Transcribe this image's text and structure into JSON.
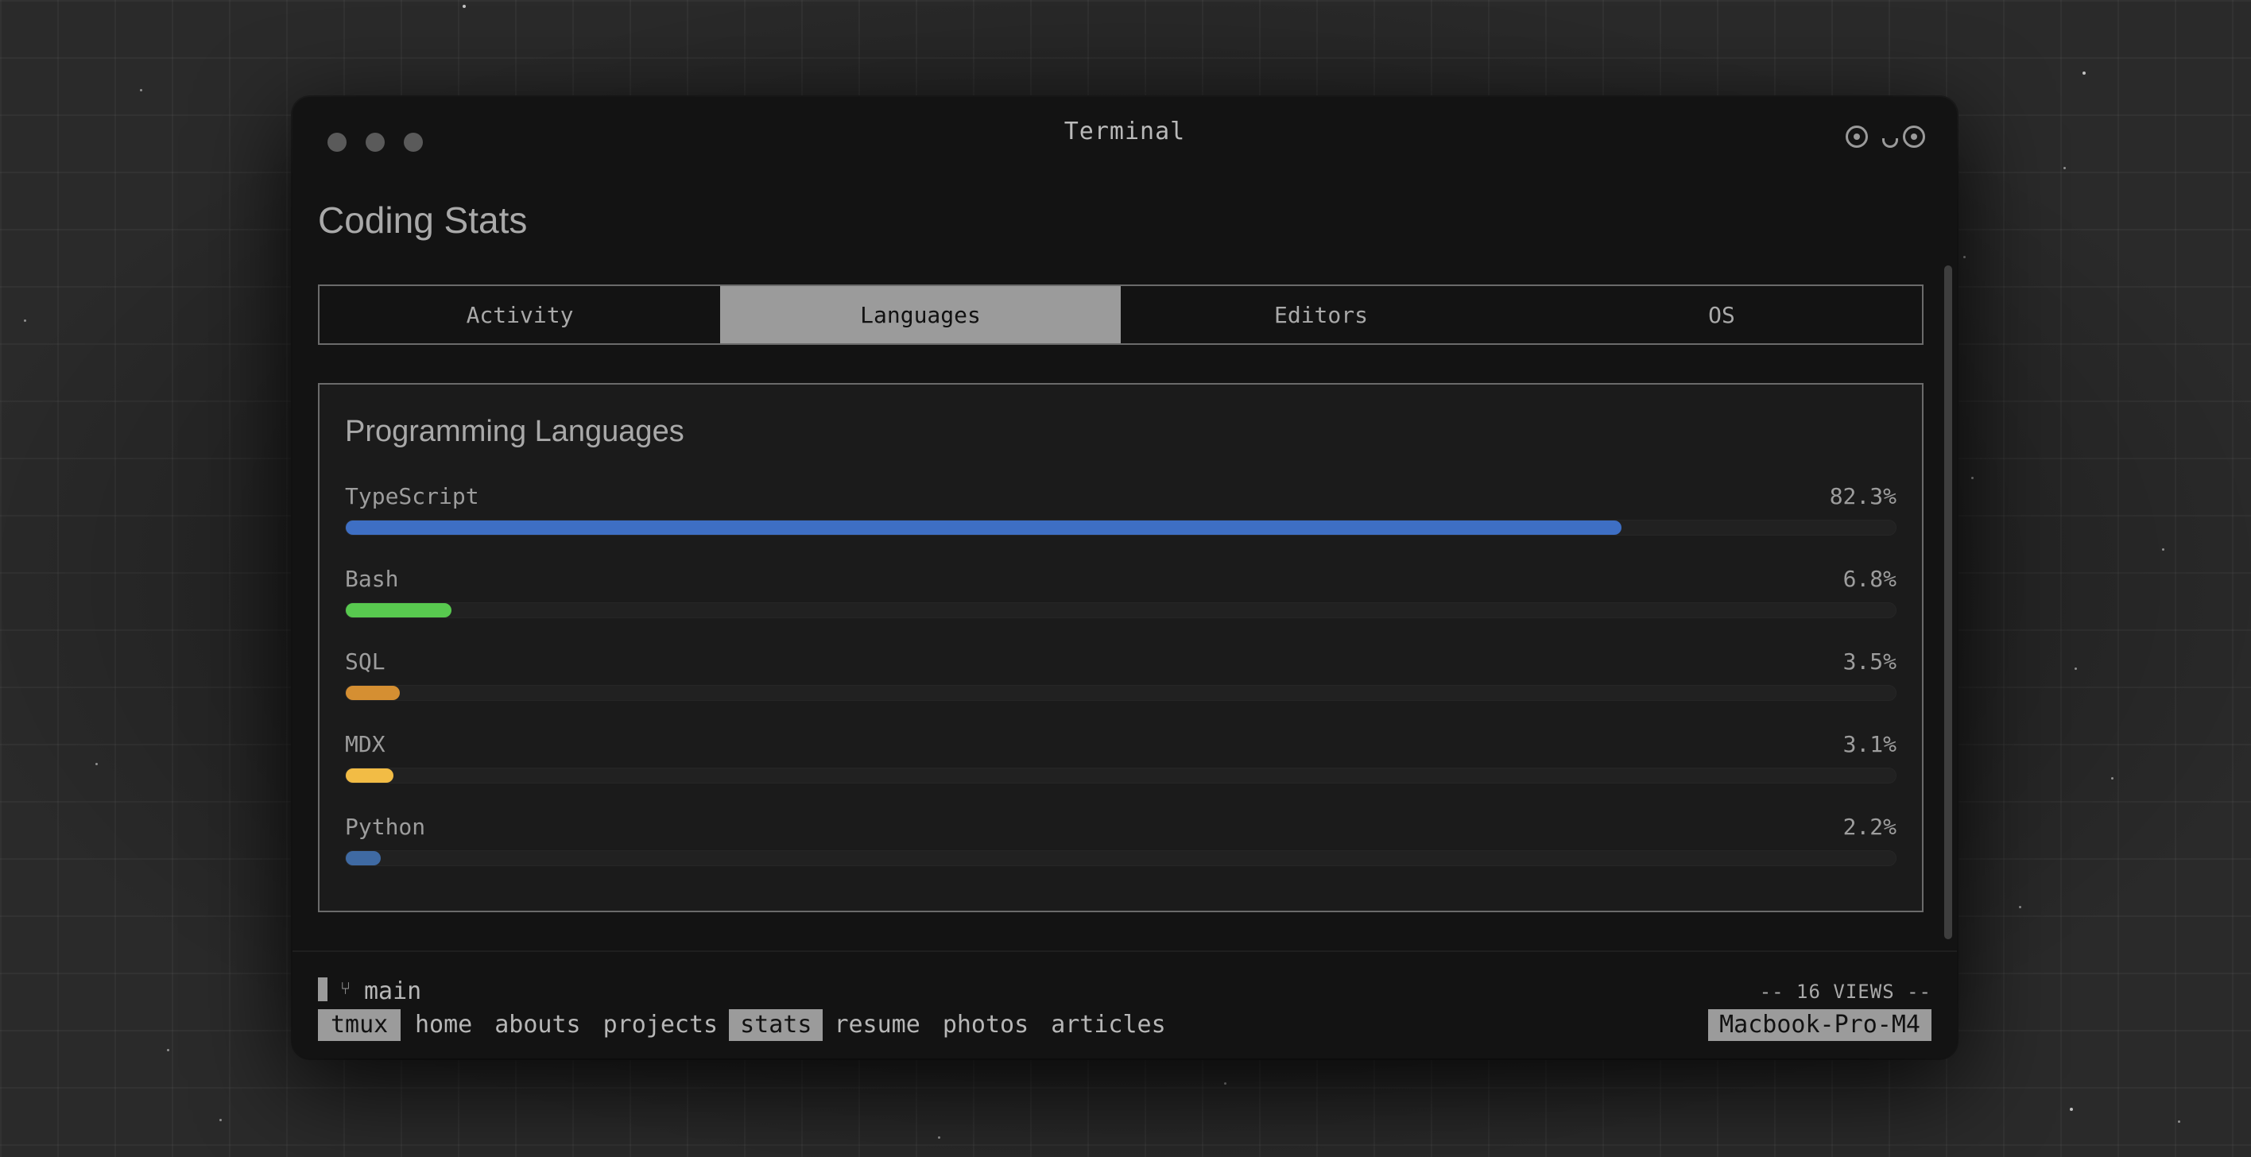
{
  "window": {
    "title": "Terminal"
  },
  "page": {
    "title": "Coding Stats"
  },
  "tabs": [
    {
      "label": "Activity",
      "active": false
    },
    {
      "label": "Languages",
      "active": true
    },
    {
      "label": "Editors",
      "active": false
    },
    {
      "label": "OS",
      "active": false
    }
  ],
  "panel": {
    "title": "Programming Languages",
    "languages": [
      {
        "name": "TypeScript",
        "percent_label": "82.3%",
        "percent": 82.3,
        "color": "#3e6fc4"
      },
      {
        "name": "Bash",
        "percent_label": "6.8%",
        "percent": 6.8,
        "color": "#58c94f"
      },
      {
        "name": "SQL",
        "percent_label": "3.5%",
        "percent": 3.5,
        "color": "#d58f32"
      },
      {
        "name": "MDX",
        "percent_label": "3.1%",
        "percent": 3.1,
        "color": "#f2bc45"
      },
      {
        "name": "Python",
        "percent_label": "2.2%",
        "percent": 2.2,
        "color": "#3f6aa3"
      }
    ]
  },
  "statusbar": {
    "branch": "main",
    "views": "-- 16 VIEWS --",
    "session": "tmux",
    "nav": [
      {
        "label": "home",
        "active": false
      },
      {
        "label": "abouts",
        "active": false
      },
      {
        "label": "projects",
        "active": false
      },
      {
        "label": "stats",
        "active": true
      },
      {
        "label": "resume",
        "active": false
      },
      {
        "label": "photos",
        "active": false
      },
      {
        "label": "articles",
        "active": false
      }
    ],
    "host": "Macbook-Pro-M4"
  },
  "icons": {
    "traffic_lights": "window-control-dots",
    "face": "face-icon",
    "branch": "git-branch-icon"
  }
}
